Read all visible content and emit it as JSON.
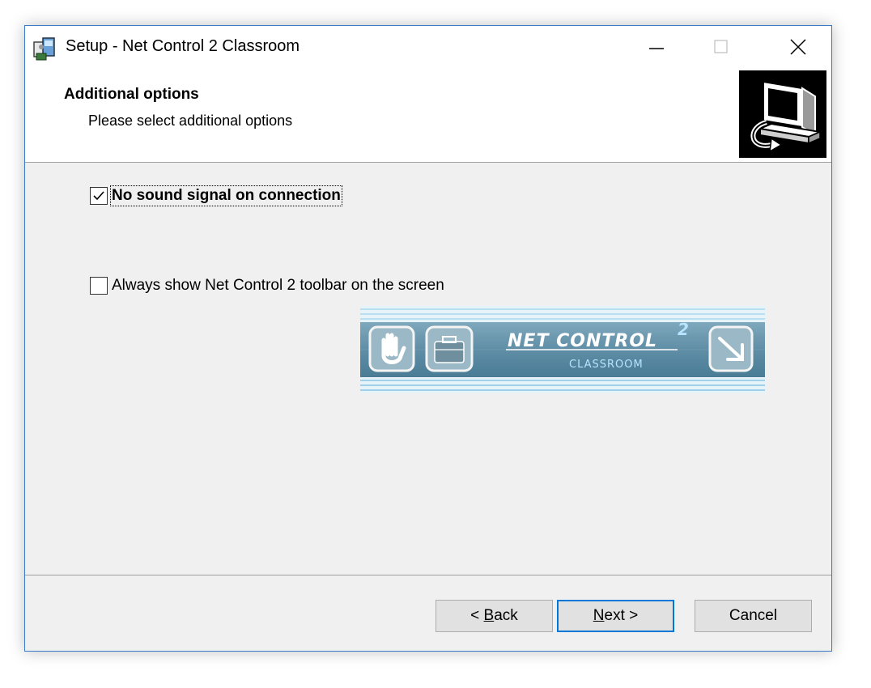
{
  "window": {
    "title": "Setup - Net Control 2 Classroom",
    "controls": {
      "minimize": "minimize-icon",
      "maximize": "maximize-icon",
      "close": "close-icon"
    }
  },
  "header": {
    "title": "Additional options",
    "subtitle": "Please select additional options",
    "graphic_icon": "computer-install-icon"
  },
  "options": [
    {
      "label": "No sound signal on connection",
      "checked": true
    },
    {
      "label": "Always show Net Control 2 toolbar on the screen",
      "checked": false
    }
  ],
  "toolbar_preview": {
    "brand_prefix": "Net Control",
    "brand_superscript": "2",
    "brand_sub": "CLASSROOM",
    "icons": [
      "raise-hand-icon",
      "briefcase-icon",
      "arrow-down-right-icon"
    ]
  },
  "buttons": {
    "back": {
      "prefix": "< ",
      "accel": "B",
      "rest": "ack"
    },
    "next": {
      "accel": "N",
      "rest": "ext >"
    },
    "cancel": "Cancel"
  },
  "colors": {
    "accent": "#0078d7",
    "window_border": "#3a79c4",
    "face": "#f0f0f0",
    "toolbar_bg": "#5f8ea6"
  }
}
